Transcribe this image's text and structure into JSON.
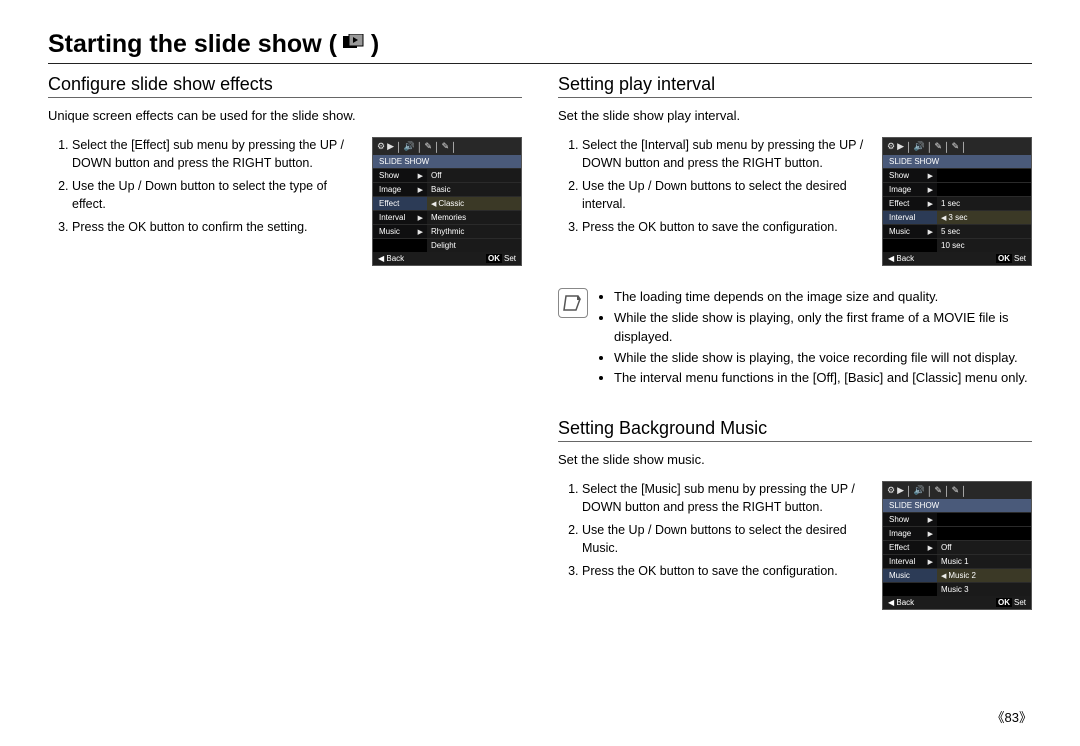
{
  "page_title": "Starting the slide show (",
  "title_icon": "slideshow-icon",
  "page_title_close": ")",
  "page_number": "《83》",
  "left": {
    "heading": "Configure slide show effects",
    "intro": "Unique screen effects can be used for the slide show.",
    "steps": [
      "Select the [Effect] sub menu by pressing the UP / DOWN button and press the RIGHT button.",
      "Use the Up / Down button to select the type of effect.",
      "Press the OK button to confirm the setting."
    ],
    "menu": {
      "title": "SLIDE SHOW",
      "rows": [
        {
          "label": "Show",
          "arrow": true,
          "opt": "Off",
          "labelSel": false,
          "optSel": false
        },
        {
          "label": "Image",
          "arrow": true,
          "opt": "Basic",
          "labelSel": false,
          "optSel": false
        },
        {
          "label": "Effect",
          "arrow": false,
          "opt": "Classic",
          "labelSel": true,
          "optSel": true,
          "optArrow": true
        },
        {
          "label": "Interval",
          "arrow": true,
          "opt": "Memories",
          "labelSel": false,
          "optSel": false
        },
        {
          "label": "Music",
          "arrow": true,
          "opt": "Rhythmic",
          "labelSel": false,
          "optSel": false
        },
        {
          "label": "",
          "arrow": false,
          "opt": "Delight",
          "labelSel": false,
          "optSel": false,
          "blankLabel": true
        }
      ],
      "foot_back": "Back",
      "foot_ok": "OK",
      "foot_set": "Set"
    }
  },
  "right": {
    "interval": {
      "heading": "Setting play interval",
      "intro": "Set the slide show play interval.",
      "steps": [
        "Select the [Interval] sub menu by pressing the UP / DOWN button and press the RIGHT button.",
        "Use the Up / Down buttons to select the desired interval.",
        "Press the OK button to save the configuration."
      ],
      "menu": {
        "title": "SLIDE SHOW",
        "rows": [
          {
            "label": "Show",
            "arrow": true,
            "opt": "",
            "labelSel": false,
            "optSel": false,
            "blankOpt": true
          },
          {
            "label": "Image",
            "arrow": true,
            "opt": "",
            "labelSel": false,
            "optSel": false,
            "blankOpt": true
          },
          {
            "label": "Effect",
            "arrow": true,
            "opt": "1 sec",
            "labelSel": false,
            "optSel": false
          },
          {
            "label": "Interval",
            "arrow": false,
            "opt": "3 sec",
            "labelSel": true,
            "optSel": true,
            "optArrow": true
          },
          {
            "label": "Music",
            "arrow": true,
            "opt": "5 sec",
            "labelSel": false,
            "optSel": false
          },
          {
            "label": "",
            "arrow": false,
            "opt": "10 sec",
            "labelSel": false,
            "optSel": false,
            "blankLabel": true
          }
        ],
        "foot_back": "Back",
        "foot_ok": "OK",
        "foot_set": "Set"
      }
    },
    "notes": [
      "The loading time depends on the image size and quality.",
      "While the slide show is playing, only the first frame of a MOVIE file is displayed.",
      "While the slide show is playing, the voice recording file will not display.",
      "The interval menu functions in the [Off], [Basic] and [Classic] menu only."
    ],
    "music": {
      "heading": "Setting Background Music",
      "intro": "Set the slide show music.",
      "steps": [
        "Select the [Music] sub menu by pressing the UP / DOWN button and press the RIGHT button.",
        "Use the Up / Down buttons to select the desired Music.",
        "Press the OK button to save the configuration."
      ],
      "menu": {
        "title": "SLIDE SHOW",
        "rows": [
          {
            "label": "Show",
            "arrow": true,
            "opt": "",
            "labelSel": false,
            "optSel": false,
            "blankOpt": true
          },
          {
            "label": "Image",
            "arrow": true,
            "opt": "",
            "labelSel": false,
            "optSel": false,
            "blankOpt": true
          },
          {
            "label": "Effect",
            "arrow": true,
            "opt": "Off",
            "labelSel": false,
            "optSel": false
          },
          {
            "label": "Interval",
            "arrow": true,
            "opt": "Music 1",
            "labelSel": false,
            "optSel": false
          },
          {
            "label": "Music",
            "arrow": false,
            "opt": "Music 2",
            "labelSel": true,
            "optSel": true,
            "optArrow": true
          },
          {
            "label": "",
            "arrow": false,
            "opt": "Music 3",
            "labelSel": false,
            "optSel": false,
            "blankLabel": true
          }
        ],
        "foot_back": "Back",
        "foot_ok": "OK",
        "foot_set": "Set"
      }
    }
  }
}
